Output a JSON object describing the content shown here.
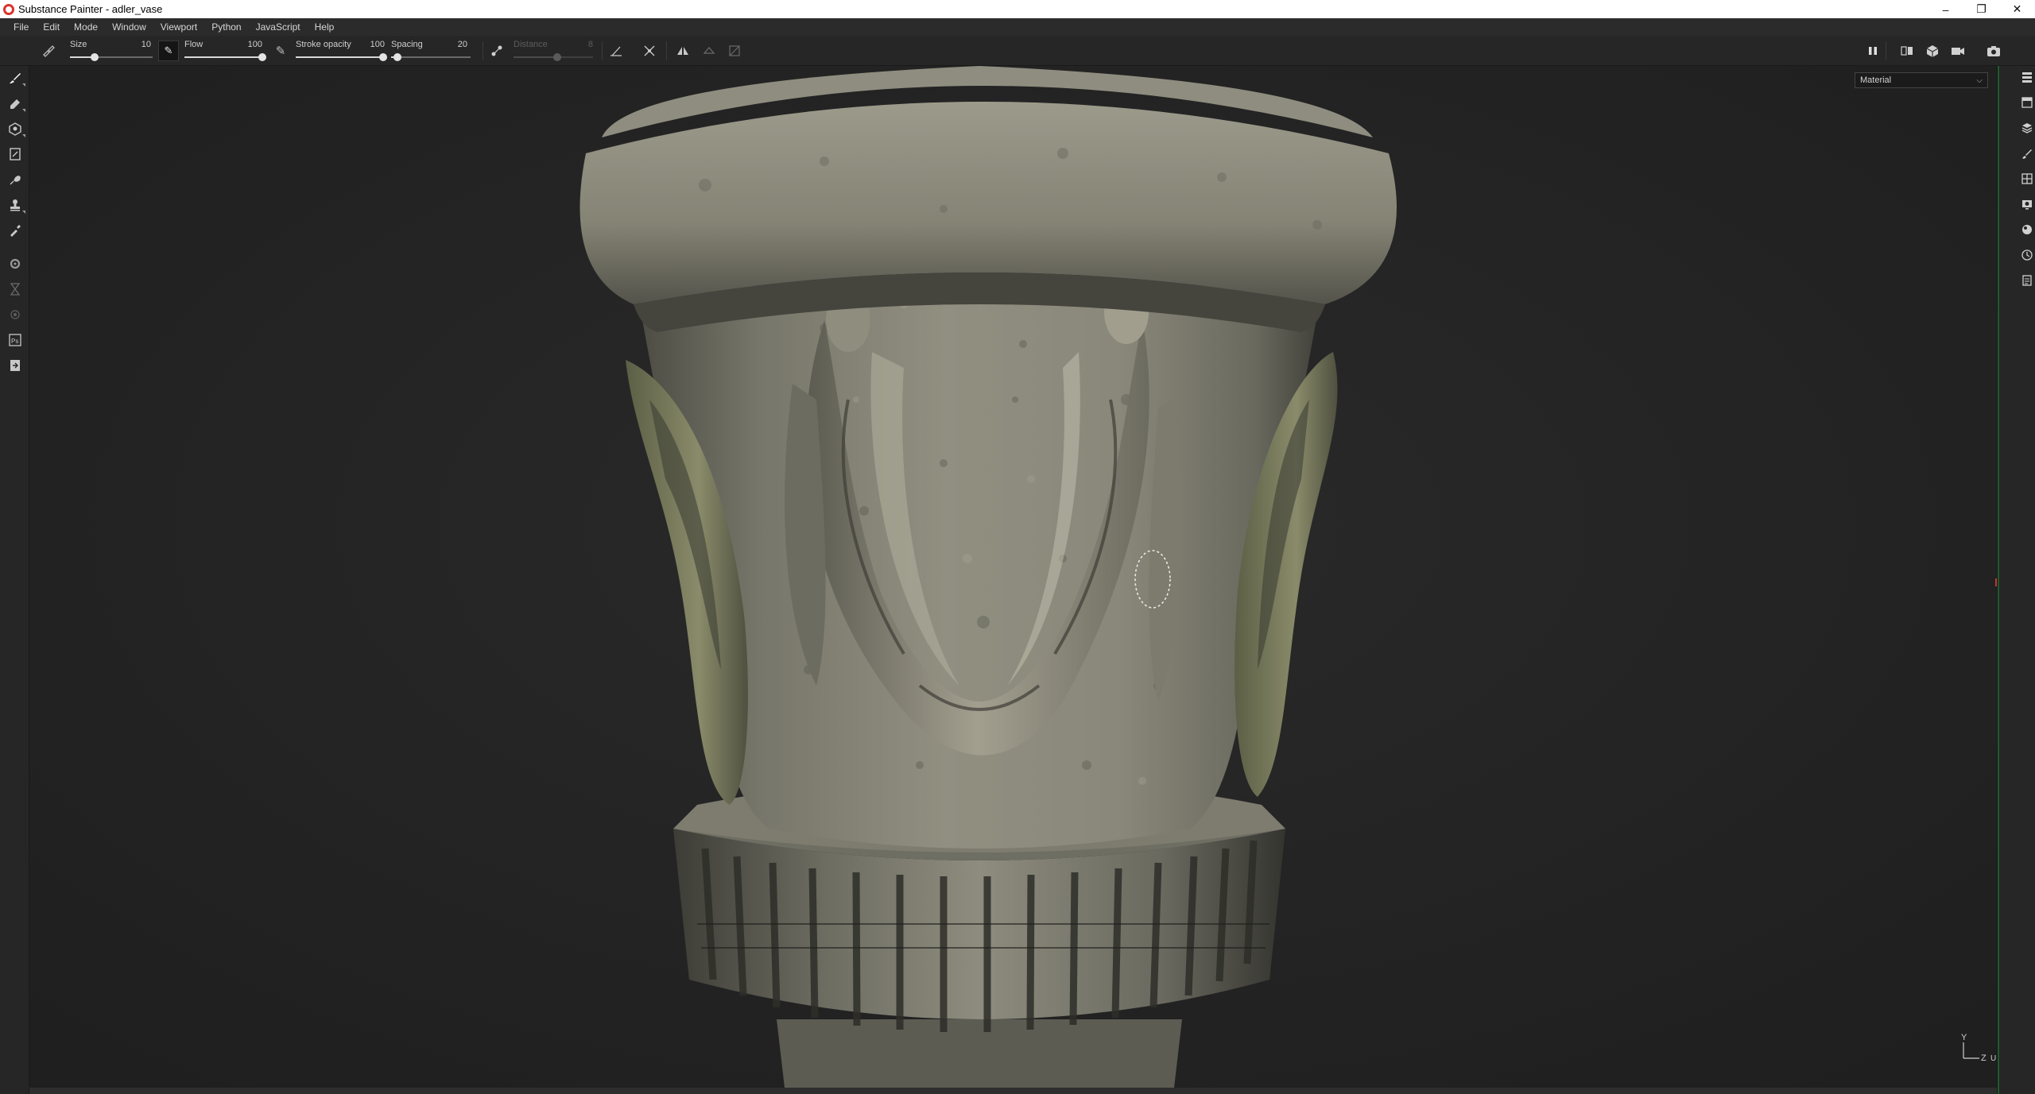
{
  "window": {
    "title": "Substance Painter - adler_vase",
    "controls": {
      "minimize": "–",
      "maximize": "❐",
      "close": "✕"
    }
  },
  "menu": {
    "items": [
      "File",
      "Edit",
      "Mode",
      "Window",
      "Viewport",
      "Python",
      "JavaScript",
      "Help"
    ]
  },
  "toolbar": {
    "size": {
      "label": "Size",
      "value": "10",
      "level": 0.3
    },
    "flow": {
      "label": "Flow",
      "value": "100",
      "level": 1.0
    },
    "stroke_opacity": {
      "label": "Stroke opacity",
      "value": "100",
      "level": 1.0
    },
    "spacing": {
      "label": "Spacing",
      "value": "20",
      "level": 0.08
    },
    "distance": {
      "label": "Distance",
      "value": "8",
      "level": 0.55,
      "enabled": false
    }
  },
  "viewport": {
    "channel_selector": {
      "value": "Material",
      "chevron": "⌵"
    },
    "axis_gizmo": {
      "y": "Y",
      "z": "Z",
      "u": "U"
    }
  },
  "icons": {
    "left_tools": [
      "paint-brush",
      "eraser",
      "projection",
      "polygon-fill",
      "smudge",
      "clone-stamp",
      "color-picker",
      "bake-settings",
      "hourglass",
      "physics",
      "photoshop-export",
      "export-textures"
    ],
    "right_panels": [
      "layers",
      "texture-set-list",
      "texture-set-settings",
      "properties",
      "display-settings",
      "viewer-settings",
      "shader-settings",
      "history",
      "log"
    ]
  },
  "colors": {
    "accent_red": "#d9342b",
    "background": "#242424",
    "stone": "#8e8c7d"
  }
}
